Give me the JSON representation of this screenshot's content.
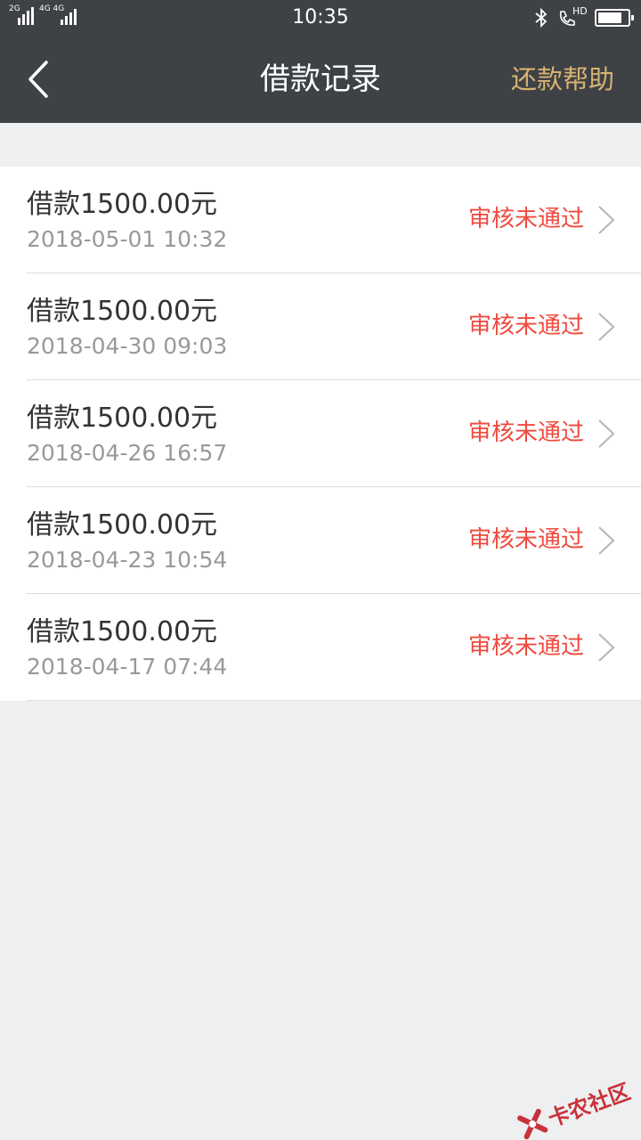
{
  "status_bar": {
    "sim1_tag": "2G",
    "sim2_tag": "4G 4G",
    "time": "10:35",
    "bluetooth_icon": "bluetooth-icon",
    "call_hd_icon": "hd-call-icon",
    "hd_label": "HD",
    "battery_icon": "battery-icon"
  },
  "header": {
    "back_icon": "chevron-left-icon",
    "title": "借款记录",
    "help_link": "还款帮助",
    "help_color": "#d6b373",
    "bar_color": "#3e4145"
  },
  "records": [
    {
      "amount": "借款1500.00元",
      "date": "2018-05-01 10:32",
      "status": "审核未通过"
    },
    {
      "amount": "借款1500.00元",
      "date": "2018-04-30 09:03",
      "status": "审核未通过"
    },
    {
      "amount": "借款1500.00元",
      "date": "2018-04-26 16:57",
      "status": "审核未通过"
    },
    {
      "amount": "借款1500.00元",
      "date": "2018-04-23 10:54",
      "status": "审核未通过"
    },
    {
      "amount": "借款1500.00元",
      "date": "2018-04-17 07:44",
      "status": "审核未通过"
    }
  ],
  "status_color": "#f04a3e",
  "watermark": {
    "text": "卡农社区"
  }
}
